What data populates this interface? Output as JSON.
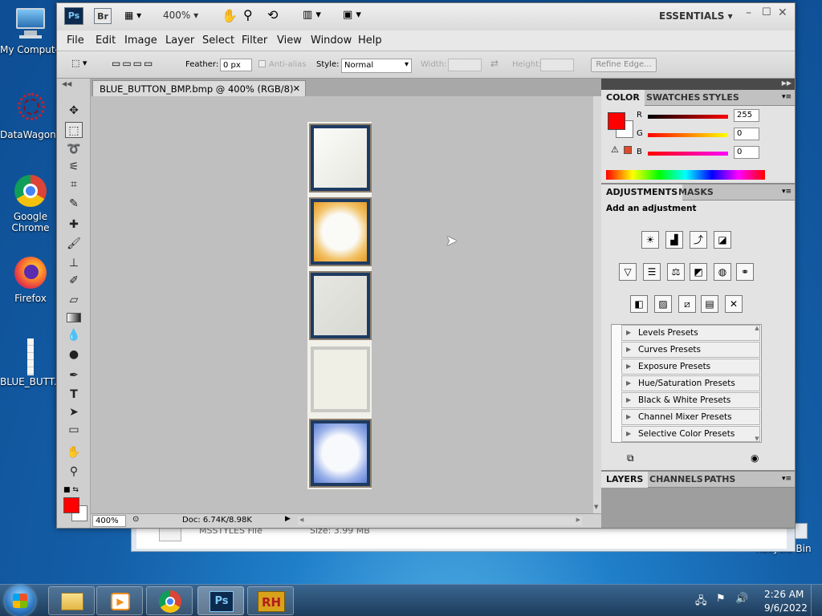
{
  "desktop": {
    "icons": [
      {
        "label": "My Compute"
      },
      {
        "label": "DataWagon..."
      },
      {
        "label": "Google Chrome"
      },
      {
        "label": "Firefox"
      },
      {
        "label": "BLUE_BUTT..."
      },
      {
        "label": "Recycle Bin"
      }
    ]
  },
  "behind_window": {
    "file_type": "MSSTYLES File",
    "size": "Size: 3.99 MB"
  },
  "app": {
    "ps_logo": "Ps",
    "br_logo": "Br",
    "zoom_select": "400%",
    "workspace": "ESSENTIALS"
  },
  "menu": [
    "File",
    "Edit",
    "Image",
    "Layer",
    "Select",
    "Filter",
    "View",
    "Window",
    "Help"
  ],
  "options": {
    "feather_label": "Feather:",
    "feather_value": "0 px",
    "antialias_label": "Anti-alias",
    "style_label": "Style:",
    "style_value": "Normal",
    "width_label": "Width:",
    "height_label": "Height:",
    "refine_edge": "Refine Edge..."
  },
  "document": {
    "tab_title": "BLUE_BUTTON_BMP.bmp @ 400% (RGB/8)",
    "status_zoom": "400%",
    "doc_size": "Doc: 6.74K/8.98K"
  },
  "panels": {
    "color": {
      "tabs": [
        "COLOR",
        "SWATCHES",
        "STYLES"
      ],
      "r_label": "R",
      "g_label": "G",
      "b_label": "B",
      "r": "255",
      "g": "0",
      "b": "0",
      "fg_color": "#ff0000",
      "bg_color": "#ffffff"
    },
    "adjustments": {
      "tabs": [
        "ADJUSTMENTS",
        "MASKS"
      ],
      "title": "Add an adjustment",
      "presets": [
        "Levels Presets",
        "Curves Presets",
        "Exposure Presets",
        "Hue/Saturation Presets",
        "Black & White Presets",
        "Channel Mixer Presets",
        "Selective Color Presets"
      ]
    },
    "layers": {
      "tabs": [
        "LAYERS",
        "CHANNELS",
        "PATHS"
      ]
    }
  },
  "taskbar": {
    "rh_label": "RH",
    "ps_label": "Ps",
    "time": "2:26 AM",
    "date": "9/6/2022"
  },
  "colors": {
    "accent": "#1b3a63",
    "orange": "#f2a33a",
    "blue_button": "#6f8fd8"
  }
}
